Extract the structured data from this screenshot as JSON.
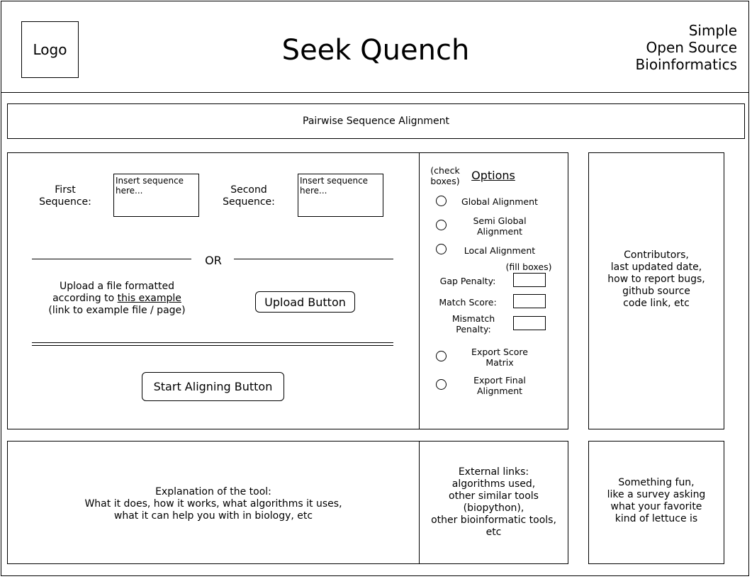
{
  "header": {
    "logo_label": "Logo",
    "title": "Seek Quench",
    "tagline": [
      "Simple",
      "Open Source",
      "Bioinformatics"
    ]
  },
  "banner": {
    "label": "Pairwise Sequence Alignment"
  },
  "input_panel": {
    "first_label": [
      "First",
      "Sequence:"
    ],
    "second_label": [
      "Second",
      "Sequence:"
    ],
    "first_placeholder": "Insert sequence here...",
    "second_placeholder": "Insert sequence here...",
    "or_label": "OR",
    "upload_text_line1": "Upload a file formatted",
    "upload_text_prefix": "according to ",
    "upload_link": "this example",
    "upload_text_line3": "(link to example file / page)",
    "upload_button": "Upload Button",
    "start_button": "Start Aligning Button"
  },
  "options": {
    "check_note": [
      "(check",
      "boxes)"
    ],
    "title": "Options",
    "radios": [
      {
        "label": [
          "Global Alignment"
        ]
      },
      {
        "label": [
          "Semi Global",
          "Alignment"
        ]
      },
      {
        "label": [
          "Local Alignment"
        ]
      }
    ],
    "fill_note": "(fill boxes)",
    "fields": [
      {
        "label": [
          "Gap Penalty:"
        ]
      },
      {
        "label": [
          "Match Score:"
        ]
      },
      {
        "label": [
          "Mismatch",
          "Penalty:"
        ]
      }
    ],
    "exports": [
      {
        "label": [
          "Export Score",
          "Matrix"
        ]
      },
      {
        "label": [
          "Export Final",
          "Alignment"
        ]
      }
    ]
  },
  "contributors": {
    "lines": [
      "Contributors,",
      "last updated date,",
      "how to report bugs,",
      "github source",
      "code link, etc"
    ]
  },
  "explanation": {
    "lines": [
      "Explanation of the tool:",
      "What it does, how it works, what algorithms it uses,",
      "what it can help you with in biology, etc"
    ]
  },
  "external_links": {
    "lines": [
      "External links:",
      "algorithms used,",
      "other similar tools",
      "(biopython),",
      "other bioinformatic tools,",
      "etc"
    ]
  },
  "fun": {
    "lines": [
      "Something fun,",
      "like a survey asking",
      "what your favorite",
      "kind of lettuce is"
    ]
  }
}
